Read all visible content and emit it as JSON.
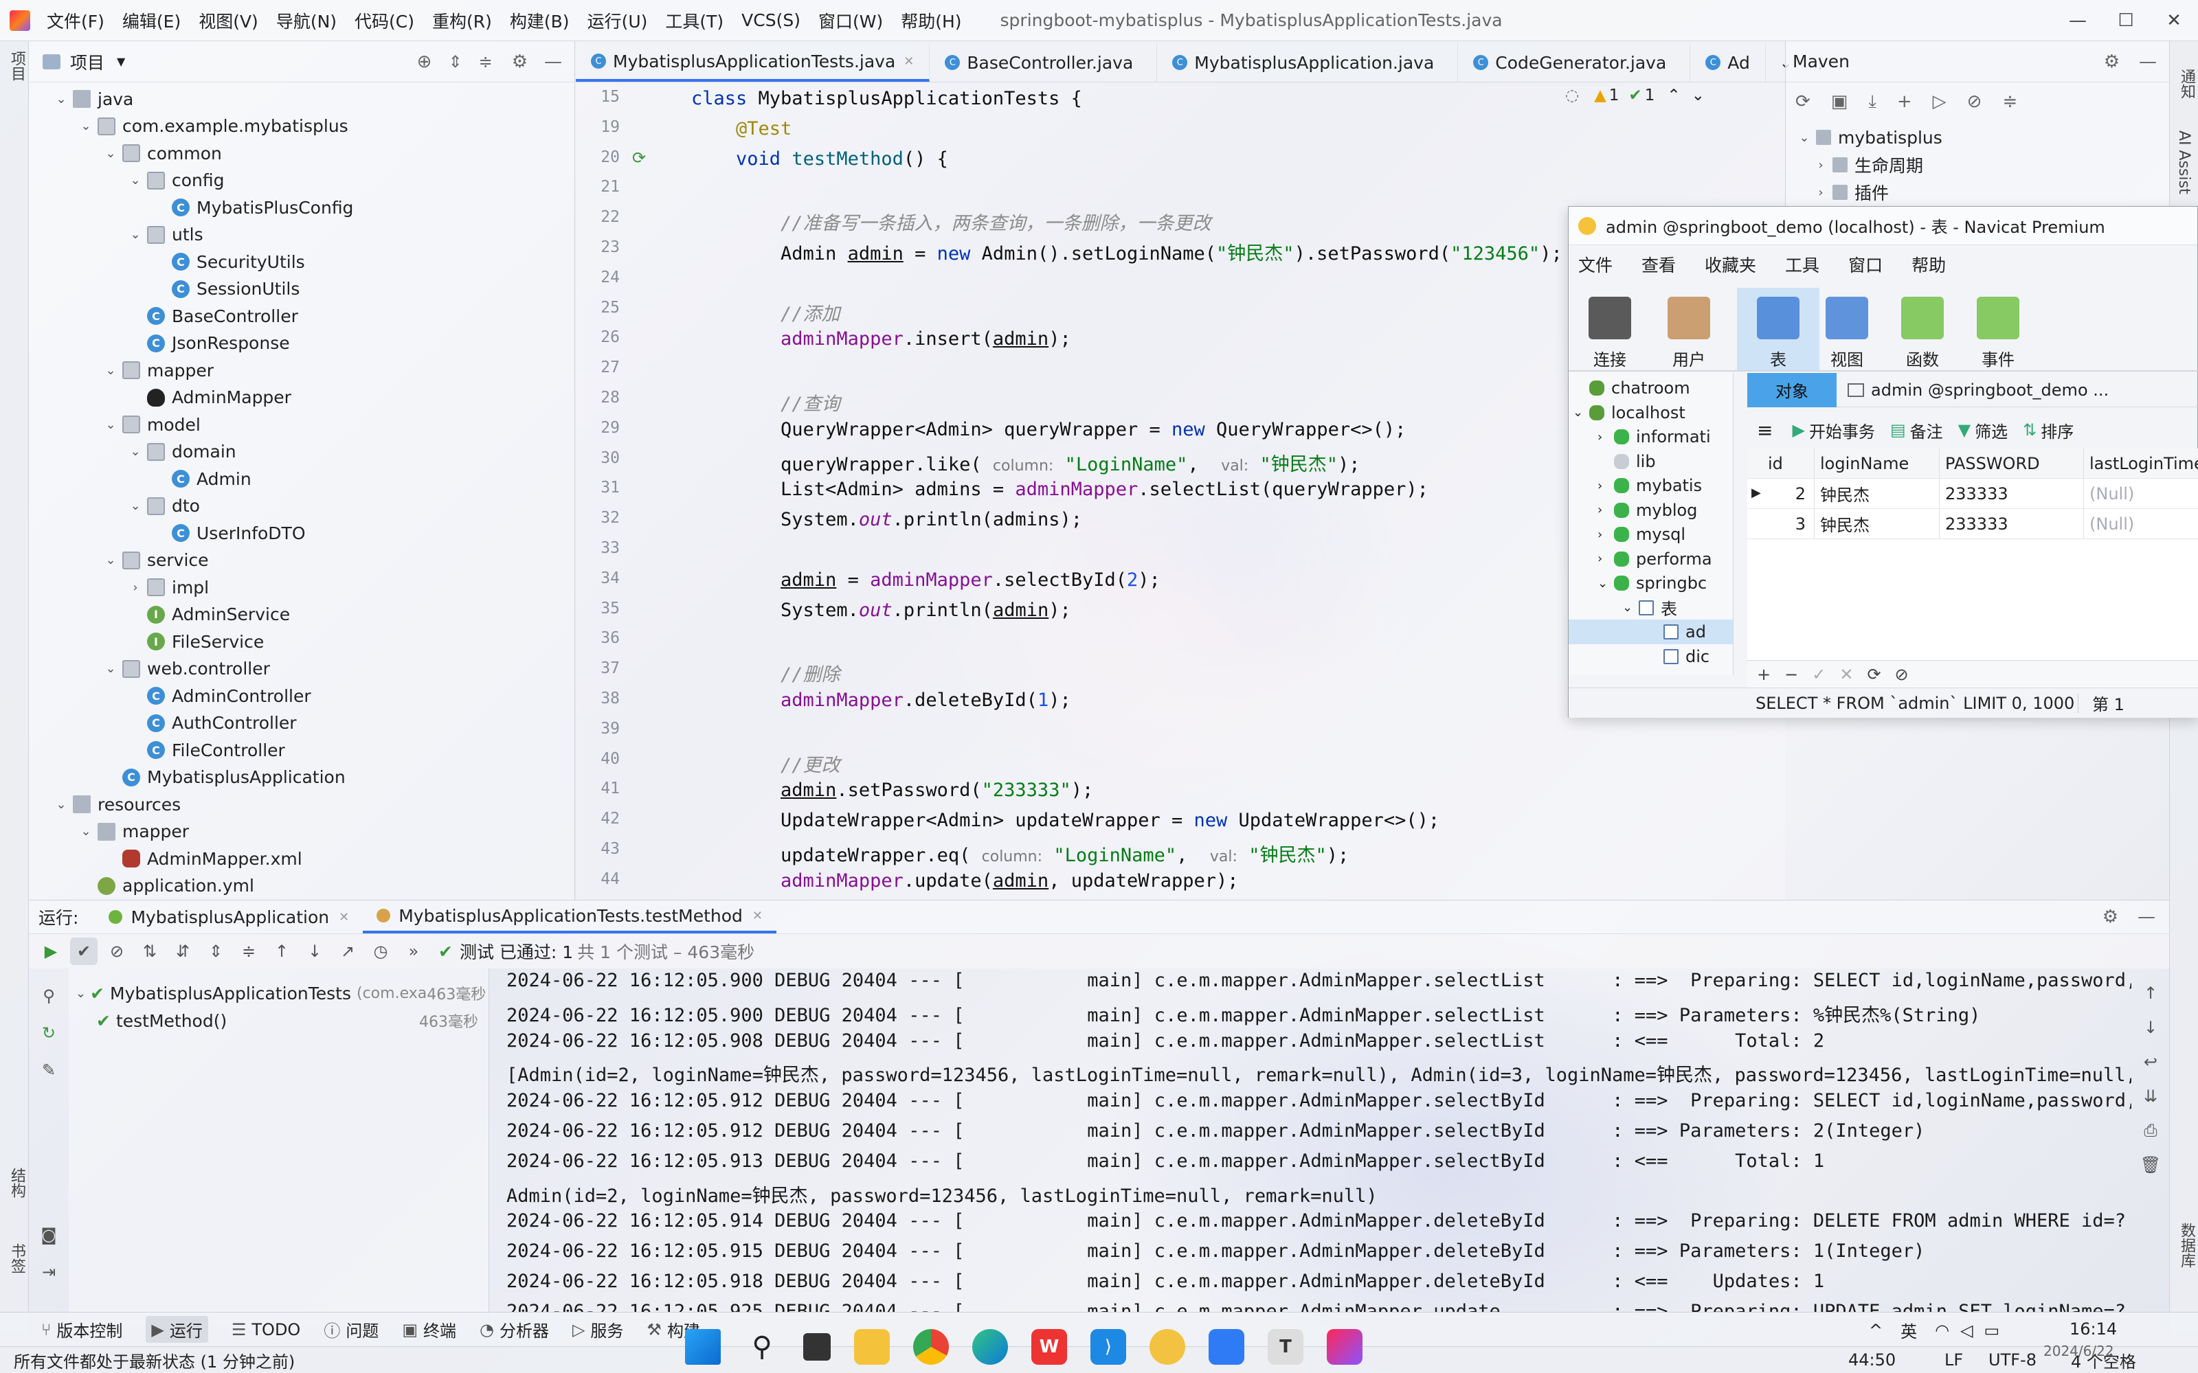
{
  "window": {
    "title": "springboot-mybatisplus - MybatisplusApplicationTests.java",
    "menu": [
      "文件(F)",
      "编辑(E)",
      "视图(V)",
      "导航(N)",
      "代码(C)",
      "重构(R)",
      "构建(B)",
      "运行(U)",
      "工具(T)",
      "VCS(S)",
      "窗口(W)",
      "帮助(H)"
    ]
  },
  "left_strip": {
    "project": "项目",
    "structure": "结构",
    "bookmarks": "书签"
  },
  "right_strip": {
    "notifications": "通知",
    "ai": "AI Assist",
    "database": "数据库"
  },
  "project": {
    "title": "项目",
    "tree": [
      {
        "label": "java",
        "depth": 0,
        "icon": "folder",
        "arrow": "down"
      },
      {
        "label": "com.example.mybatisplus",
        "depth": 1,
        "icon": "package",
        "arrow": "down"
      },
      {
        "label": "common",
        "depth": 2,
        "icon": "package",
        "arrow": "down"
      },
      {
        "label": "config",
        "depth": 3,
        "icon": "package",
        "arrow": "down"
      },
      {
        "label": "MybatisPlusConfig",
        "depth": 4,
        "icon": "class",
        "arrow": ""
      },
      {
        "label": "utls",
        "depth": 3,
        "icon": "package",
        "arrow": "down"
      },
      {
        "label": "SecurityUtils",
        "depth": 4,
        "icon": "class",
        "arrow": ""
      },
      {
        "label": "SessionUtils",
        "depth": 4,
        "icon": "class",
        "arrow": ""
      },
      {
        "label": "BaseController",
        "depth": 3,
        "icon": "class",
        "arrow": ""
      },
      {
        "label": "JsonResponse",
        "depth": 3,
        "icon": "class",
        "arrow": ""
      },
      {
        "label": "mapper",
        "depth": 2,
        "icon": "package",
        "arrow": "down"
      },
      {
        "label": "AdminMapper",
        "depth": 3,
        "icon": "mapper",
        "arrow": ""
      },
      {
        "label": "model",
        "depth": 2,
        "icon": "package",
        "arrow": "down"
      },
      {
        "label": "domain",
        "depth": 3,
        "icon": "package",
        "arrow": "down"
      },
      {
        "label": "Admin",
        "depth": 4,
        "icon": "class",
        "arrow": ""
      },
      {
        "label": "dto",
        "depth": 3,
        "icon": "package",
        "arrow": "down"
      },
      {
        "label": "UserInfoDTO",
        "depth": 4,
        "icon": "class",
        "arrow": ""
      },
      {
        "label": "service",
        "depth": 2,
        "icon": "package",
        "arrow": "down"
      },
      {
        "label": "impl",
        "depth": 3,
        "icon": "package",
        "arrow": "right"
      },
      {
        "label": "AdminService",
        "depth": 3,
        "icon": "interface",
        "arrow": ""
      },
      {
        "label": "FileService",
        "depth": 3,
        "icon": "interface",
        "arrow": ""
      },
      {
        "label": "web.controller",
        "depth": 2,
        "icon": "package",
        "arrow": "down"
      },
      {
        "label": "AdminController",
        "depth": 3,
        "icon": "class",
        "arrow": ""
      },
      {
        "label": "AuthController",
        "depth": 3,
        "icon": "class",
        "arrow": ""
      },
      {
        "label": "FileController",
        "depth": 3,
        "icon": "class",
        "arrow": ""
      },
      {
        "label": "MybatisplusApplication",
        "depth": 2,
        "icon": "class",
        "arrow": ""
      },
      {
        "label": "resources",
        "depth": 0,
        "icon": "folder",
        "arrow": "down"
      },
      {
        "label": "mapper",
        "depth": 1,
        "icon": "folder",
        "arrow": "down"
      },
      {
        "label": "AdminMapper.xml",
        "depth": 2,
        "icon": "xml",
        "arrow": ""
      },
      {
        "label": "application.yml",
        "depth": 1,
        "icon": "yml",
        "arrow": ""
      }
    ]
  },
  "editor": {
    "tabs": [
      "MybatisplusApplicationTests.java",
      "BaseController.java",
      "MybatisplusApplication.java",
      "CodeGenerator.java",
      "Ad"
    ],
    "inspection": {
      "warnings": "1",
      "ok": "1"
    },
    "lines": [
      {
        "n": "15",
        "html": "<span class=\"kw\">class</span> MybatisplusApplicationTests {"
      },
      {
        "n": "19",
        "html": "    <span class=\"ann\">@Test</span>"
      },
      {
        "n": "20",
        "html": "    <span class=\"kw\">void</span> <span class=\"kw\" style=\"color:#00627a\">testMethod</span>() {"
      },
      {
        "n": "21",
        "html": ""
      },
      {
        "n": "22",
        "html": "        <span class=\"cm\">//准备写一条插入，两条查询，一条删除，一条更改</span>"
      },
      {
        "n": "23",
        "html": "        Admin <span class=\"ul\">admin</span> = <span class=\"kw\">new</span> Admin().setLoginName(<span class=\"str\">\"钟民杰\"</span>).setPassword(<span class=\"str\">\"123456\"</span>);"
      },
      {
        "n": "24",
        "html": ""
      },
      {
        "n": "25",
        "html": "        <span class=\"cm\">//添加</span>"
      },
      {
        "n": "26",
        "html": "        <span class=\"fld\">adminMapper</span>.insert(<span class=\"ul\">admin</span>);"
      },
      {
        "n": "27",
        "html": ""
      },
      {
        "n": "28",
        "html": "        <span class=\"cm\">//查询</span>"
      },
      {
        "n": "29",
        "html": "        QueryWrapper&lt;Admin&gt; queryWrapper = <span class=\"kw\">new</span> QueryWrapper&lt;&gt;();"
      },
      {
        "n": "30",
        "html": "        queryWrapper.like( <span class=\"hint\">column:</span> <span class=\"str\">\"LoginName\"</span>,  <span class=\"hint\">val:</span> <span class=\"str\">\"钟民杰\"</span>);"
      },
      {
        "n": "31",
        "html": "        List&lt;Admin&gt; admins = <span class=\"fld\">adminMapper</span>.selectList(queryWrapper);"
      },
      {
        "n": "32",
        "html": "        System.<span class=\"ital\">out</span>.println(admins);"
      },
      {
        "n": "33",
        "html": ""
      },
      {
        "n": "34",
        "html": "        <span class=\"ul\">admin</span> = <span class=\"fld\">adminMapper</span>.selectById(<span class=\"num\">2</span>);"
      },
      {
        "n": "35",
        "html": "        System.<span class=\"ital\">out</span>.println(<span class=\"ul\">admin</span>);"
      },
      {
        "n": "36",
        "html": ""
      },
      {
        "n": "37",
        "html": "        <span class=\"cm\">//删除</span>"
      },
      {
        "n": "38",
        "html": "        <span class=\"fld\">adminMapper</span>.deleteById(<span class=\"num\">1</span>);"
      },
      {
        "n": "39",
        "html": ""
      },
      {
        "n": "40",
        "html": "        <span class=\"cm\">//更改</span>"
      },
      {
        "n": "41",
        "html": "        <span class=\"ul\">admin</span>.setPassword(<span class=\"str\">\"233333\"</span>);"
      },
      {
        "n": "42",
        "html": "        UpdateWrapper&lt;Admin&gt; updateWrapper = <span class=\"kw\">new</span> UpdateWrapper&lt;&gt;();"
      },
      {
        "n": "43",
        "html": "        updateWrapper.eq( <span class=\"hint\">column:</span> <span class=\"str\">\"LoginName\"</span>,  <span class=\"hint\">val:</span> <span class=\"str\">\"钟民杰\"</span>);"
      },
      {
        "n": "44",
        "html": "        <span class=\"fld\">adminMapper</span>.update(<span class=\"ul\">admin</span>, updateWrapper);"
      }
    ]
  },
  "maven": {
    "title": "Maven",
    "tree": [
      "mybatisplus",
      "生命周期",
      "插件"
    ]
  },
  "navicat": {
    "title": "admin @springboot_demo (localhost) - 表 - Navicat Premium",
    "menu": [
      "文件",
      "查看",
      "收藏夹",
      "工具",
      "窗口",
      "帮助"
    ],
    "toolbar": [
      "连接",
      "用户",
      "表",
      "视图",
      "函数",
      "事件"
    ],
    "tree": [
      {
        "label": "chatroom",
        "depth": 0,
        "arrow": ""
      },
      {
        "label": "localhost",
        "depth": 0,
        "arrow": "down"
      },
      {
        "label": "informati",
        "depth": 1,
        "arrow": "right"
      },
      {
        "label": "lib",
        "depth": 1,
        "arrow": ""
      },
      {
        "label": "mybatis",
        "depth": 1,
        "arrow": "right"
      },
      {
        "label": "myblog",
        "depth": 1,
        "arrow": "right"
      },
      {
        "label": "mysql",
        "depth": 1,
        "arrow": "right"
      },
      {
        "label": "performa",
        "depth": 1,
        "arrow": "right"
      },
      {
        "label": "springbc",
        "depth": 1,
        "arrow": "down"
      },
      {
        "label": "表",
        "depth": 2,
        "arrow": "down"
      },
      {
        "label": "ad",
        "depth": 3,
        "arrow": ""
      },
      {
        "label": "dic",
        "depth": 3,
        "arrow": ""
      }
    ],
    "tabs": {
      "objects": "对象",
      "table": "admin @springboot_demo ..."
    },
    "grid_toolbar": [
      "开始事务",
      "备注",
      "筛选",
      "排序"
    ],
    "columns": [
      "id",
      "loginName",
      "PASSWORD",
      "lastLoginTime"
    ],
    "rows": [
      [
        "2",
        "钟民杰",
        "233333",
        "(Null)"
      ],
      [
        "3",
        "钟民杰",
        "233333",
        "(Null)"
      ]
    ],
    "sql": "SELECT * FROM `admin` LIMIT 0, 1000",
    "page": "第 1"
  },
  "run": {
    "label": "运行:",
    "tabs": [
      "MybatisplusApplication",
      "MybatisplusApplicationTests.testMethod"
    ],
    "result": "测试 已通过: 1",
    "result_detail": "共 1 个测试 – 463毫秒",
    "tree": [
      {
        "label": "MybatisplusApplicationTests",
        "extra": "(com.exa",
        "time": "463毫秒"
      },
      {
        "label": "testMethod()",
        "extra": "",
        "time": "463毫秒"
      }
    ],
    "console": [
      "2024-06-22 16:12:05.900 DEBUG 20404 --- [           main] c.e.m.mapper.AdminMapper.selectList      : ==>  Preparing: SELECT id,loginName,password,l",
      "2024-06-22 16:12:05.900 DEBUG 20404 --- [           main] c.e.m.mapper.AdminMapper.selectList      : ==> Parameters: %钟民杰%(String)",
      "2024-06-22 16:12:05.908 DEBUG 20404 --- [           main] c.e.m.mapper.AdminMapper.selectList      : <==      Total: 2",
      "[Admin(id=2, loginName=钟民杰, password=123456, lastLoginTime=null, remark=null), Admin(id=3, loginName=钟民杰, password=123456, lastLoginTime=null, r",
      "2024-06-22 16:12:05.912 DEBUG 20404 --- [           main] c.e.m.mapper.AdminMapper.selectById      : ==>  Preparing: SELECT id,loginName,password,l",
      "2024-06-22 16:12:05.912 DEBUG 20404 --- [           main] c.e.m.mapper.AdminMapper.selectById      : ==> Parameters: 2(Integer)",
      "2024-06-22 16:12:05.913 DEBUG 20404 --- [           main] c.e.m.mapper.AdminMapper.selectById      : <==      Total: 1",
      "Admin(id=2, loginName=钟民杰, password=123456, lastLoginTime=null, remark=null)",
      "2024-06-22 16:12:05.914 DEBUG 20404 --- [           main] c.e.m.mapper.AdminMapper.deleteById      : ==>  Preparing: DELETE FROM admin WHERE id=?",
      "2024-06-22 16:12:05.915 DEBUG 20404 --- [           main] c.e.m.mapper.AdminMapper.deleteById      : ==> Parameters: 1(Integer)",
      "2024-06-22 16:12:05.918 DEBUG 20404 --- [           main] c.e.m.mapper.AdminMapper.deleteById      : <==    Updates: 1",
      "2024-06-22 16:12:05.925 DEBUG 20404 --- [           main] c.e.m.mapper.AdminMapper.update          : ==>  Preparing: UPDATE admin SET loginName=?"
    ]
  },
  "bottom": {
    "items": [
      "版本控制",
      "运行",
      "TODO",
      "问题",
      "终端",
      "分析器",
      "服务",
      "构建"
    ]
  },
  "status": {
    "message": "所有文件都处于最新状态 (1 分钟之前)",
    "position": "44:50",
    "line_sep": "LF",
    "encoding": "UTF-8",
    "indent": "4 个空格"
  },
  "taskbar": {
    "ime": "英",
    "time": "16:14",
    "date": "2024/6/22"
  }
}
